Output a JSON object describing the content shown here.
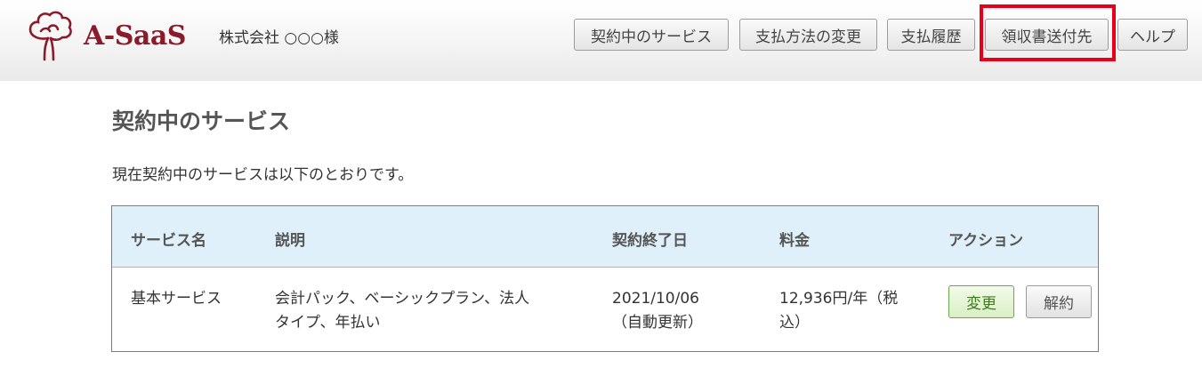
{
  "header": {
    "logo_text": "A-SaaS",
    "company_name": "株式会社 ○○○様",
    "nav": [
      {
        "label": "契約中のサービス"
      },
      {
        "label": "支払方法の変更"
      },
      {
        "label": "支払履歴"
      },
      {
        "label": "領収書送付先"
      },
      {
        "label": "ヘルプ"
      }
    ],
    "highlighted_item": "領収書送付先",
    "highlight_color": "#e8001a",
    "brand_color": "#8a1b2a"
  },
  "main": {
    "title": "契約中のサービス",
    "intro": "現在契約中のサービスは以下のとおりです。",
    "table": {
      "columns": [
        "サービス名",
        "説明",
        "契約終了日",
        "料金",
        "アクション"
      ],
      "rows": [
        {
          "service_name": "基本サービス",
          "description_line1": "会計パック、ベーシックプラン、法人",
          "description_line2": "タイプ、年払い",
          "end_date_line1": "2021/10/06",
          "end_date_line2": "（自動更新）",
          "price_line1": "12,936円/年（税",
          "price_line2": "込）",
          "actions": {
            "change": "変更",
            "cancel": "解約"
          }
        }
      ],
      "header_bg": "#dff0fb"
    }
  }
}
